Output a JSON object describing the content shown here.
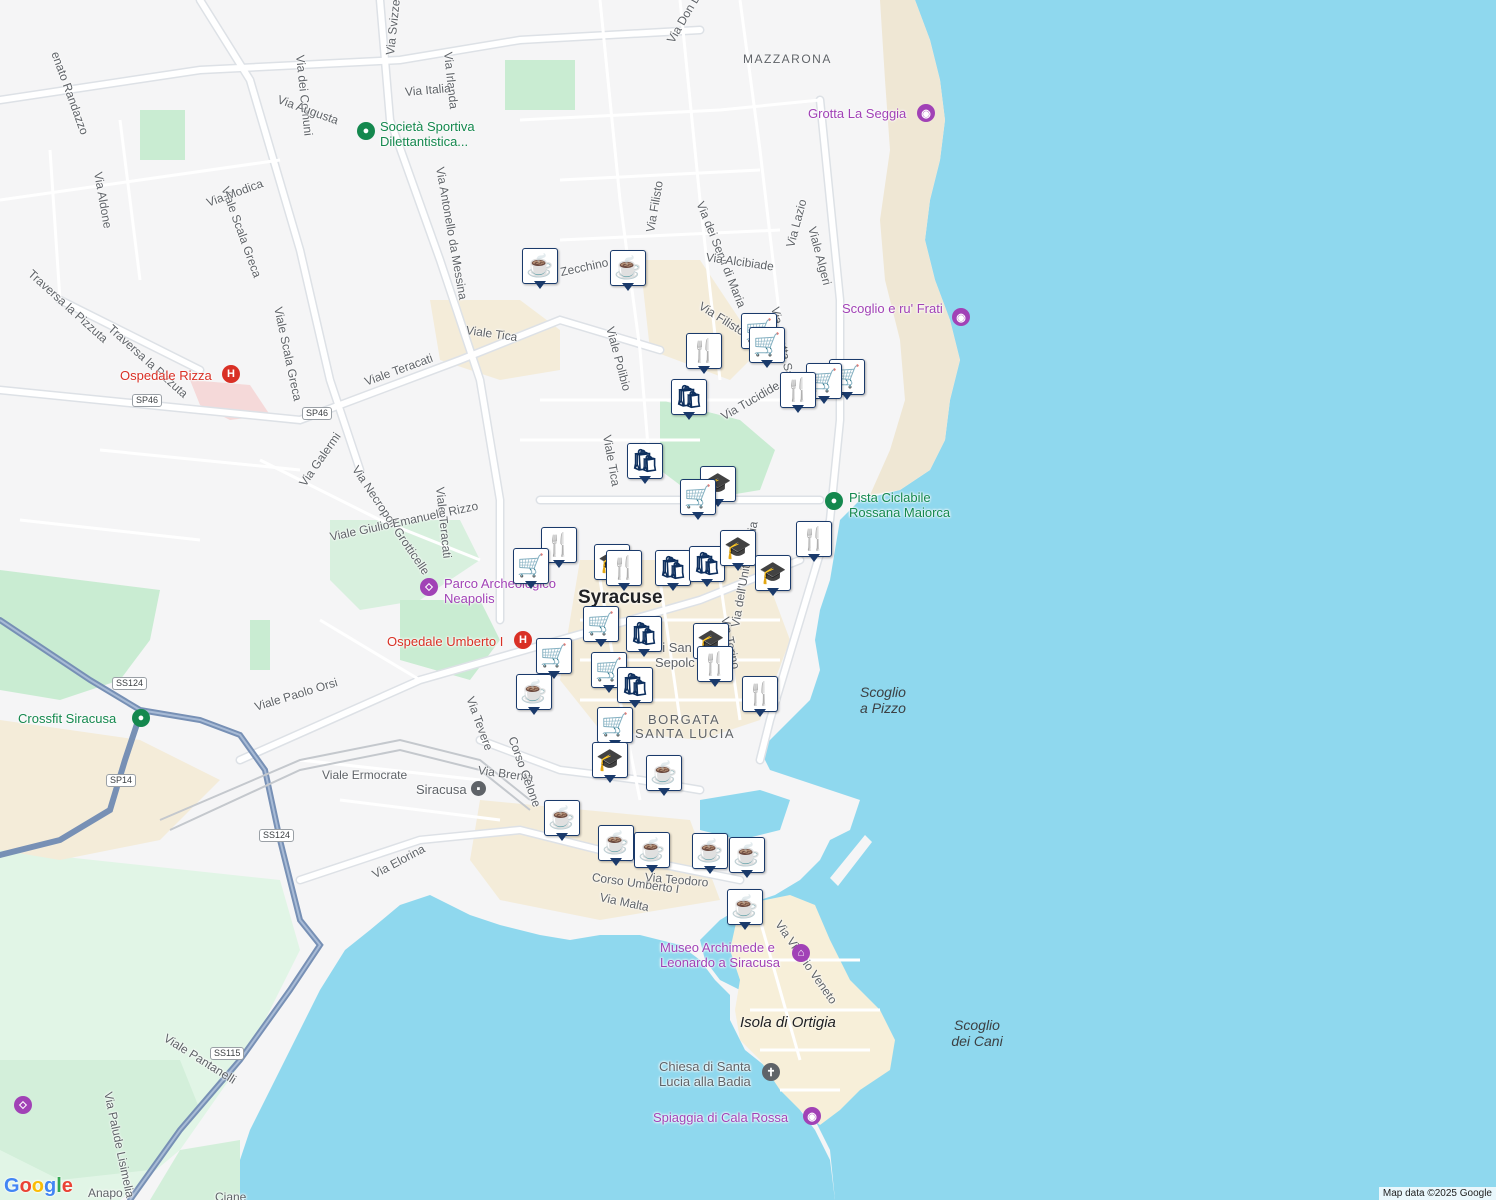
{
  "map": {
    "attribution": "Map data ©2025 Google",
    "logo": "Google",
    "colors": {
      "water": "#8fd8ee",
      "land": "#f5f5f6",
      "park": "#c9ecd2",
      "road": "#ffffff",
      "highway": "#8ca4c4",
      "marker_border": "#1a3a6b",
      "marker_icon": "#0d2f5e"
    }
  },
  "streets": [
    "Via Augusta",
    "Via Italia",
    "Via dei Comuni",
    "Via Svizzera",
    "Via Irlanda",
    "Via Antonello da Messina",
    "Via Don Luigi Sturzo",
    "Viale Scala Greca",
    "Via Modica",
    "Via Aldone",
    "Traversa la Pizzuta",
    "Viale Tica",
    "Viale Teracati",
    "Via Necropoli Grotticelle",
    "Via Galermi",
    "Viale Giulio Emanuele Rizzo",
    "Viale Paolo Orsi",
    "Viale Ermocrate",
    "Via Brenta",
    "Via Elorina",
    "Viale Pantanelli",
    "Via Palude Lisimelia",
    "Via Tevere",
    "Corso Gelone",
    "Via Filisto",
    "Via dei Servi di Maria",
    "Via Alcibiade",
    "Via Grotta Santa",
    "Via Lazio",
    "Viale Algeri",
    "Via Tucidide",
    "Via Torino",
    "Via dell'Unità d'Italia",
    "V.le Zecchino",
    "Viale Polibio",
    "Corso Umberto I",
    "Via Malta",
    "Via Vittorio Veneto",
    "Viale Tica",
    "Viale Teracati",
    "Via Teodoro"
  ],
  "areas": {
    "mazzarona": "MAZZARONA",
    "borgata_1": "BORGATA",
    "borgata_2": "SANTA LUCIA"
  },
  "city": "Syracuse",
  "isola": "Isola di Ortigia",
  "sea_labels": {
    "pizzo": "Scoglio\na Pizzo",
    "cani": "Scoglio\ndei Cani"
  },
  "pois": {
    "grotta": "Grotta La Seggia",
    "scoglio_frati": "Scoglio e ru' Frati",
    "societa_1": "Società Sportiva",
    "societa_2": "Dilettantistica...",
    "ospedale_rizza": "Ospedale Rizza",
    "pista_1": "Pista Ciclabile",
    "pista_2": "Rossana Maiorca",
    "parco_1": "Parco Archeologico",
    "parco_2": "Neapolis",
    "ospedale_umberto": "Ospedale Umberto I",
    "crossfit": "Crossfit Siracusa",
    "stazione": "Siracusa",
    "museo_1": "Museo Archimede e",
    "museo_2": "Leonardo a Siracusa",
    "chiesa_1": "Chiesa di Santa",
    "chiesa_2": "Lucia alla Badia",
    "spiaggia": "Spiaggia di Cala Rossa",
    "sepolcro_1": "di San",
    "sepolcro_2": "Sepolc",
    "anapo": "Anapo",
    "ciane": "Ciane"
  },
  "shields": {
    "sp46a": "SP46",
    "sp46b": "SP46",
    "ss124a": "SS124",
    "ss124b": "SS124",
    "sp14": "SP14",
    "ss115": "SS115"
  },
  "markers": [
    {
      "type": "cafe",
      "icon": "☕"
    },
    {
      "type": "cafe",
      "icon": "☕"
    },
    {
      "type": "restaurant",
      "icon": "🍴"
    },
    {
      "type": "grocery",
      "icon": "🛒"
    },
    {
      "type": "grocery",
      "icon": "🛒"
    },
    {
      "type": "grocery",
      "icon": "🛒"
    },
    {
      "type": "restaurant",
      "icon": "🍴"
    },
    {
      "type": "shopping",
      "icon": "🛍"
    },
    {
      "type": "shopping",
      "icon": "🛍"
    },
    {
      "type": "school",
      "icon": "🎓"
    },
    {
      "type": "grocery",
      "icon": "🛒"
    },
    {
      "type": "restaurant",
      "icon": "🍴"
    },
    {
      "type": "grocery",
      "icon": "🛒"
    },
    {
      "type": "restaurant",
      "icon": "🍴"
    },
    {
      "type": "restaurant",
      "icon": "🍴"
    },
    {
      "type": "shopping",
      "icon": "🛍"
    },
    {
      "type": "shopping",
      "icon": "🛍"
    },
    {
      "type": "school",
      "icon": "🎓"
    },
    {
      "type": "school",
      "icon": "🎓"
    },
    {
      "type": "restaurant",
      "icon": "🍴"
    },
    {
      "type": "grocery",
      "icon": "🛒"
    },
    {
      "type": "shopping",
      "icon": "🛍"
    },
    {
      "type": "grocery",
      "icon": "🛒"
    },
    {
      "type": "school",
      "icon": "🎓"
    },
    {
      "type": "restaurant",
      "icon": "🍴"
    },
    {
      "type": "grocery",
      "icon": "🛒"
    },
    {
      "type": "shopping",
      "icon": "🛍"
    },
    {
      "type": "cafe",
      "icon": "☕"
    },
    {
      "type": "restaurant",
      "icon": "🍴"
    },
    {
      "type": "grocery",
      "icon": "🛒"
    },
    {
      "type": "school",
      "icon": "🎓"
    },
    {
      "type": "cafe",
      "icon": "☕"
    },
    {
      "type": "cafe",
      "icon": "☕"
    },
    {
      "type": "cafe",
      "icon": "☕"
    },
    {
      "type": "cafe",
      "icon": "☕"
    },
    {
      "type": "cafe",
      "icon": "☕"
    },
    {
      "type": "cafe",
      "icon": "☕"
    },
    {
      "type": "cafe",
      "icon": "☕"
    }
  ]
}
